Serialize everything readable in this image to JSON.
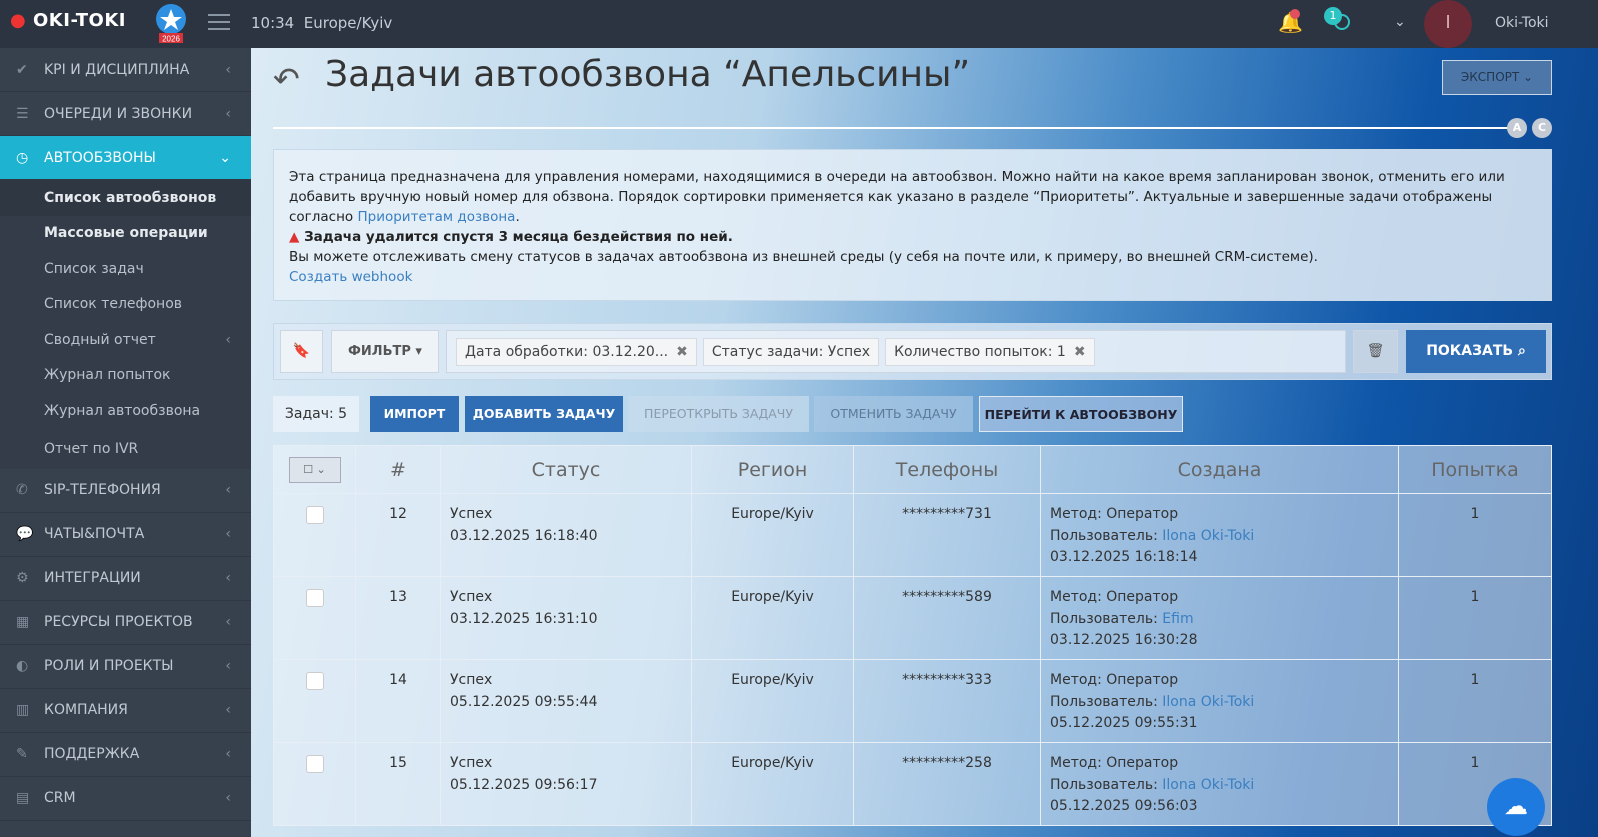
{
  "header": {
    "logo": "OKI-TOKI",
    "badge_year": "2026",
    "time": "10:34",
    "timezone": "Europe/Kyiv",
    "queue_count": "1",
    "avatar_letter": "I",
    "user": "Oki-Toki"
  },
  "sidebar": {
    "items": [
      {
        "label": "KPI И ДИСЦИПЛИНА",
        "icon": "✔"
      },
      {
        "label": "ОЧЕРЕДИ И ЗВОНКИ",
        "icon": "☰"
      },
      {
        "label": "АВТООБЗВОНЫ",
        "icon": "◷"
      },
      {
        "label": "SIP-ТЕЛЕФОНИЯ",
        "icon": "✆"
      },
      {
        "label": "ЧАТЫ&ПОЧТА",
        "icon": "💬"
      },
      {
        "label": "ИНТЕГРАЦИИ",
        "icon": "⚙"
      },
      {
        "label": "РЕСУРСЫ ПРОЕКТОВ",
        "icon": "▦"
      },
      {
        "label": "РОЛИ И ПРОЕКТЫ",
        "icon": "◐"
      },
      {
        "label": "КОМПАНИЯ",
        "icon": "▥"
      },
      {
        "label": "ПОДДЕРЖКА",
        "icon": "✎"
      },
      {
        "label": "CRM",
        "icon": "▤"
      }
    ],
    "sub": [
      "Список автообзвонов",
      "Массовые операции",
      "Список задач",
      "Список телефонов",
      "Сводный отчет",
      "Журнал попыток",
      "Журнал автообзвона",
      "Отчет по IVR"
    ]
  },
  "page": {
    "title": "Задачи автообзвона “Апельсины”",
    "export": "ЭКСПОРТ",
    "mark_a": "A",
    "mark_c": "C"
  },
  "info": {
    "text1": "Эта страница предназначена для управления номерами, находящимися в очереди на автообзвон. Можно найти на какое время запланирован звонок, отменить его или добавить вручную новый номер для обзвона. Порядок сортировки применяется как указано в разделе “Приоритеты”. Актуальные и завершенные задачи отображены согласно ",
    "link1": "Приоритетам дозвона",
    "warning": "Задача удалится спустя 3 месяца бездействия по ней.",
    "text2": "Вы можете отслеживать смену статусов в задачах автообзвона из внешней среды (у себя на почте или, к примеру, во внешней CRM-системе).",
    "link2": "Создать webhook"
  },
  "filter": {
    "label": "ФИЛЬТР",
    "chips": [
      "Дата обработки: 03.12.20...",
      "Статус задачи: Успех",
      "Количество попыток: 1"
    ],
    "show": "ПОКАЗАТЬ"
  },
  "actions": {
    "count": "Задач: 5",
    "import": "ИМПОРТ",
    "add": "ДОБАВИТЬ ЗАДАЧУ",
    "reopen": "ПЕРЕОТКРЫТЬ ЗАДАЧУ",
    "cancel": "ОТМЕНИТЬ ЗАДАЧУ",
    "goto": "ПЕРЕЙТИ К АВТООБЗВОНУ"
  },
  "table": {
    "columns": [
      "#",
      "Статус",
      "Регион",
      "Телефоны",
      "Создана",
      "Попытка"
    ],
    "rows": [
      {
        "id": "12",
        "status": "Успех",
        "status_time": "03.12.2025 16:18:40",
        "region": "Europe/Kyiv",
        "phone": "*********731",
        "method": "Метод: Оператор",
        "user_label": "Пользователь: ",
        "user": "Ilona Oki-Toki",
        "created": "03.12.2025 16:18:14",
        "attempt": "1"
      },
      {
        "id": "13",
        "status": "Успех",
        "status_time": "03.12.2025 16:31:10",
        "region": "Europe/Kyiv",
        "phone": "*********589",
        "method": "Метод: Оператор",
        "user_label": "Пользователь: ",
        "user": "Efim",
        "created": "03.12.2025 16:30:28",
        "attempt": "1"
      },
      {
        "id": "14",
        "status": "Успех",
        "status_time": "05.12.2025 09:55:44",
        "region": "Europe/Kyiv",
        "phone": "*********333",
        "method": "Метод: Оператор",
        "user_label": "Пользователь: ",
        "user": "Ilona Oki-Toki",
        "created": "05.12.2025 09:55:31",
        "attempt": "1"
      },
      {
        "id": "15",
        "status": "Успех",
        "status_time": "05.12.2025 09:56:17",
        "region": "Europe/Kyiv",
        "phone": "*********258",
        "method": "Метод: Оператор",
        "user_label": "Пользователь: ",
        "user": "Ilona Oki-Toki",
        "created": "05.12.2025 09:56:03",
        "attempt": "1"
      }
    ]
  }
}
